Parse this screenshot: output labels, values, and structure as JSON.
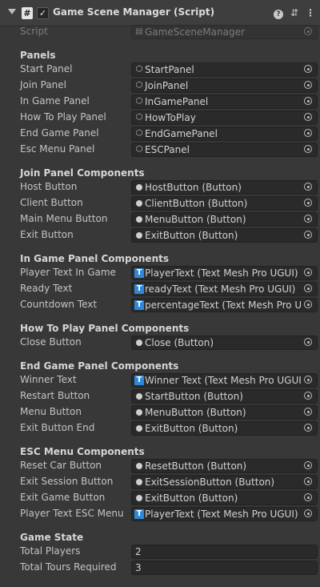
{
  "header": {
    "script_icon": "#",
    "checkbox": "✓",
    "title": "Game Scene Manager (Script)",
    "help_icon": "?",
    "presets_icon": "⇵",
    "more_icon": "⋮"
  },
  "script_row": {
    "label": "Script",
    "value": "GameSceneManager"
  },
  "sections": {
    "panels": "Panels",
    "join": "Join Panel Components",
    "ingame": "In Game Panel Components",
    "howto": "How To Play Panel Components",
    "endgame": "End Game Panel Components",
    "esc": "ESC Menu Components",
    "state": "Game State"
  },
  "panels": [
    {
      "label": "Start Panel",
      "value": "StartPanel"
    },
    {
      "label": "Join Panel",
      "value": "JoinPanel"
    },
    {
      "label": "In Game Panel",
      "value": "InGamePanel"
    },
    {
      "label": "How To Play Panel",
      "value": "HowToPlay"
    },
    {
      "label": "End Game Panel",
      "value": "EndGamePanel"
    },
    {
      "label": "Esc Menu Panel",
      "value": "ESCPanel"
    }
  ],
  "join": [
    {
      "label": "Host Button",
      "value": "HostButton (Button)"
    },
    {
      "label": "Client Button",
      "value": "ClientButton (Button)"
    },
    {
      "label": "Main Menu Button",
      "value": "MenuButton (Button)"
    },
    {
      "label": "Exit Button",
      "value": "ExitButton  (Button)"
    }
  ],
  "ingame": [
    {
      "label": "Player Text In Game",
      "value": "PlayerText (Text Mesh Pro UGUI)"
    },
    {
      "label": "Ready Text",
      "value": "readyText  (Text Mesh Pro UGUI)"
    },
    {
      "label": "Countdown Text",
      "value": "percentageText (Text Mesh Pro UGUI)"
    }
  ],
  "howto": [
    {
      "label": "Close Button",
      "value": "Close (Button)"
    }
  ],
  "endgame": [
    {
      "label": "Winner Text",
      "value": "Winner Text (Text Mesh Pro UGUI)",
      "kind": "tmp"
    },
    {
      "label": "Restart Button",
      "value": "StartButton (Button)",
      "kind": "btn"
    },
    {
      "label": "Menu Button",
      "value": "MenuButton (Button)",
      "kind": "btn"
    },
    {
      "label": "Exit Button End",
      "value": "ExitButton  (Button)",
      "kind": "btn"
    }
  ],
  "esc": [
    {
      "label": "Reset Car Button",
      "value": "ResetButton (Button)",
      "kind": "btn"
    },
    {
      "label": "Exit Session Button",
      "value": "ExitSessionButton (Button)",
      "kind": "btn"
    },
    {
      "label": "Exit Game Button",
      "value": "ExitButton  (Button)",
      "kind": "btn"
    },
    {
      "label": "Player Text ESC Menu",
      "value": "PlayerText (Text Mesh Pro UGUI)",
      "kind": "tmp"
    }
  ],
  "state": [
    {
      "label": "Total Players",
      "value": "2"
    },
    {
      "label": "Total Tours Required",
      "value": "3"
    }
  ],
  "icons": {
    "gameobject": "cube-icon",
    "button": "button-component-icon",
    "tmp": "text-mesh-pro-icon",
    "picker": "object-picker-icon",
    "script": "script-asset-icon"
  },
  "colors": {
    "background": "#383838",
    "header": "#3e3e3e",
    "field": "#2a2a2a",
    "tmp_icon": "#2f88d8",
    "text": "#c4c4c4"
  }
}
